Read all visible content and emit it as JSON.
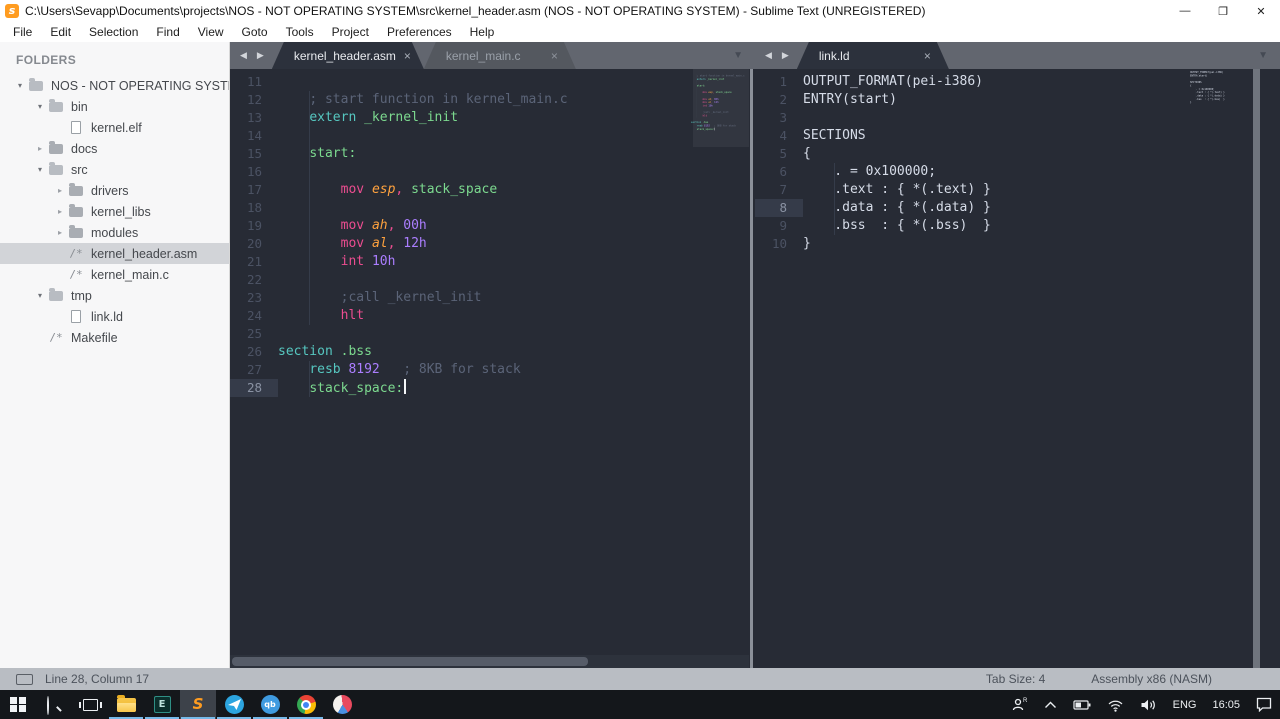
{
  "window": {
    "title": "C:\\Users\\Sevapp\\Documents\\projects\\NOS - NOT OPERATING SYSTEM\\src\\kernel_header.asm (NOS - NOT OPERATING SYSTEM) - Sublime Text (UNREGISTERED)",
    "controls": {
      "minimize": "—",
      "restore": "❐",
      "close": "✕"
    }
  },
  "menu": {
    "items": [
      "File",
      "Edit",
      "Selection",
      "Find",
      "View",
      "Goto",
      "Tools",
      "Project",
      "Preferences",
      "Help"
    ]
  },
  "sidebar": {
    "header": "FOLDERS",
    "items": [
      {
        "label": "NOS - NOT OPERATING SYSTEM",
        "depth": 0,
        "icon": "folder-open",
        "arrow": "open"
      },
      {
        "label": "bin",
        "depth": 1,
        "icon": "folder-open",
        "arrow": "open"
      },
      {
        "label": "kernel.elf",
        "depth": 2,
        "icon": "file"
      },
      {
        "label": "docs",
        "depth": 1,
        "icon": "folder",
        "arrow": "closed"
      },
      {
        "label": "src",
        "depth": 1,
        "icon": "folder-open",
        "arrow": "open"
      },
      {
        "label": "drivers",
        "depth": 2,
        "icon": "folder",
        "arrow": "closed"
      },
      {
        "label": "kernel_libs",
        "depth": 2,
        "icon": "folder",
        "arrow": "closed"
      },
      {
        "label": "modules",
        "depth": 2,
        "icon": "folder",
        "arrow": "closed"
      },
      {
        "label": "kernel_header.asm",
        "depth": 2,
        "icon": "source",
        "selected": true
      },
      {
        "label": "kernel_main.c",
        "depth": 2,
        "icon": "source"
      },
      {
        "label": "tmp",
        "depth": 1,
        "icon": "folder-open",
        "arrow": "open"
      },
      {
        "label": "link.ld",
        "depth": 2,
        "icon": "file"
      },
      {
        "label": "Makefile",
        "depth": 1,
        "icon": "source"
      }
    ]
  },
  "panes": [
    {
      "name": "left",
      "tabs": [
        {
          "label": "kernel_header.asm",
          "active": true
        },
        {
          "label": "kernel_main.c",
          "active": false
        }
      ],
      "lines": [
        {
          "n": 11,
          "segs": []
        },
        {
          "n": 12,
          "g": true,
          "segs": [
            [
              "pl",
              "    "
            ],
            [
              "cm",
              "; start function in kernel_main.c"
            ]
          ]
        },
        {
          "n": 13,
          "g": true,
          "segs": [
            [
              "pl",
              "    "
            ],
            [
              "ty",
              "extern"
            ],
            [
              "pl",
              " "
            ],
            [
              "fn",
              "_kernel_init"
            ]
          ]
        },
        {
          "n": 14,
          "g": true,
          "segs": []
        },
        {
          "n": 15,
          "g": true,
          "segs": [
            [
              "pl",
              "    "
            ],
            [
              "fn",
              "start:"
            ]
          ]
        },
        {
          "n": 16,
          "g": true,
          "segs": []
        },
        {
          "n": 17,
          "g": true,
          "segs": [
            [
              "pl",
              "        "
            ],
            [
              "kw",
              "mov"
            ],
            [
              "pl",
              " "
            ],
            [
              "rg",
              "esp"
            ],
            [
              "kw",
              ","
            ],
            [
              "pl",
              " "
            ],
            [
              "fn",
              "stack_space"
            ]
          ]
        },
        {
          "n": 18,
          "g": true,
          "segs": []
        },
        {
          "n": 19,
          "g": true,
          "segs": [
            [
              "pl",
              "        "
            ],
            [
              "kw",
              "mov"
            ],
            [
              "pl",
              " "
            ],
            [
              "rg",
              "ah"
            ],
            [
              "kw",
              ","
            ],
            [
              "pl",
              " "
            ],
            [
              "nu",
              "00h"
            ]
          ]
        },
        {
          "n": 20,
          "g": true,
          "segs": [
            [
              "pl",
              "        "
            ],
            [
              "kw",
              "mov"
            ],
            [
              "pl",
              " "
            ],
            [
              "rg",
              "al"
            ],
            [
              "kw",
              ","
            ],
            [
              "pl",
              " "
            ],
            [
              "nu",
              "12h"
            ]
          ]
        },
        {
          "n": 21,
          "g": true,
          "segs": [
            [
              "pl",
              "        "
            ],
            [
              "kw",
              "int"
            ],
            [
              "pl",
              " "
            ],
            [
              "nu",
              "10h"
            ]
          ]
        },
        {
          "n": 22,
          "g": true,
          "segs": []
        },
        {
          "n": 23,
          "g": true,
          "segs": [
            [
              "pl",
              "        "
            ],
            [
              "cm",
              ";call _kernel_init"
            ]
          ]
        },
        {
          "n": 24,
          "g": true,
          "segs": [
            [
              "pl",
              "        "
            ],
            [
              "kw",
              "hlt"
            ]
          ]
        },
        {
          "n": 25,
          "segs": []
        },
        {
          "n": 26,
          "segs": [
            [
              "ty",
              "section"
            ],
            [
              "pl",
              " "
            ],
            [
              "fn",
              ".bss"
            ]
          ]
        },
        {
          "n": 27,
          "g": true,
          "segs": [
            [
              "pl",
              "    "
            ],
            [
              "ty",
              "resb"
            ],
            [
              "pl",
              " "
            ],
            [
              "nu",
              "8192"
            ],
            [
              "pl",
              "   "
            ],
            [
              "cm",
              "; 8KB for stack"
            ]
          ]
        },
        {
          "n": 28,
          "g": true,
          "cur": true,
          "caret": true,
          "segs": [
            [
              "pl",
              "    "
            ],
            [
              "fn",
              "stack_space:"
            ]
          ]
        }
      ]
    },
    {
      "name": "right",
      "tabs": [
        {
          "label": "link.ld",
          "active": true
        }
      ],
      "lines": [
        {
          "n": 1,
          "segs": [
            [
              "pl",
              "OUTPUT_FORMAT(pei-i386)"
            ]
          ]
        },
        {
          "n": 2,
          "segs": [
            [
              "pl",
              "ENTRY(start)"
            ]
          ]
        },
        {
          "n": 3,
          "segs": []
        },
        {
          "n": 4,
          "segs": [
            [
              "pl",
              "SECTIONS"
            ]
          ]
        },
        {
          "n": 5,
          "segs": [
            [
              "pl",
              "{"
            ]
          ]
        },
        {
          "n": 6,
          "g": true,
          "segs": [
            [
              "pl",
              "    . = 0x100000;"
            ]
          ]
        },
        {
          "n": 7,
          "g": true,
          "segs": [
            [
              "pl",
              "    .text : { *(.text) }"
            ]
          ]
        },
        {
          "n": 8,
          "g": true,
          "cur": true,
          "segs": [
            [
              "pl",
              "    .data : { *(.data) }"
            ]
          ]
        },
        {
          "n": 9,
          "g": true,
          "segs": [
            [
              "pl",
              "    .bss  : { *(.bss)  }"
            ]
          ]
        },
        {
          "n": 10,
          "segs": [
            [
              "pl",
              "}"
            ]
          ]
        }
      ]
    }
  ],
  "statusbar": {
    "position": "Line 28, Column 17",
    "tab_size": "Tab Size: 4",
    "syntax": "Assembly x86 (NASM)"
  },
  "taskbar": {
    "buttons": [
      "start",
      "search",
      "task-view",
      "file-explorer",
      "e-app",
      "sublime-text",
      "telegram",
      "qbittorrent",
      "chrome",
      "media-app"
    ],
    "tray": {
      "language": "ENG",
      "time": "16:05"
    }
  },
  "colors": {
    "editor_bg": "#272b35",
    "accent_orange": "#ff9c20",
    "keyword_pink": "#ec4d90",
    "type_cyan": "#56c7c0",
    "func_green": "#7cd98f",
    "number_purple": "#ab7eff",
    "comment_gray": "#5b6478",
    "register_orange": "#ffa23e",
    "taskbar_indicator": "#76b9e8"
  }
}
